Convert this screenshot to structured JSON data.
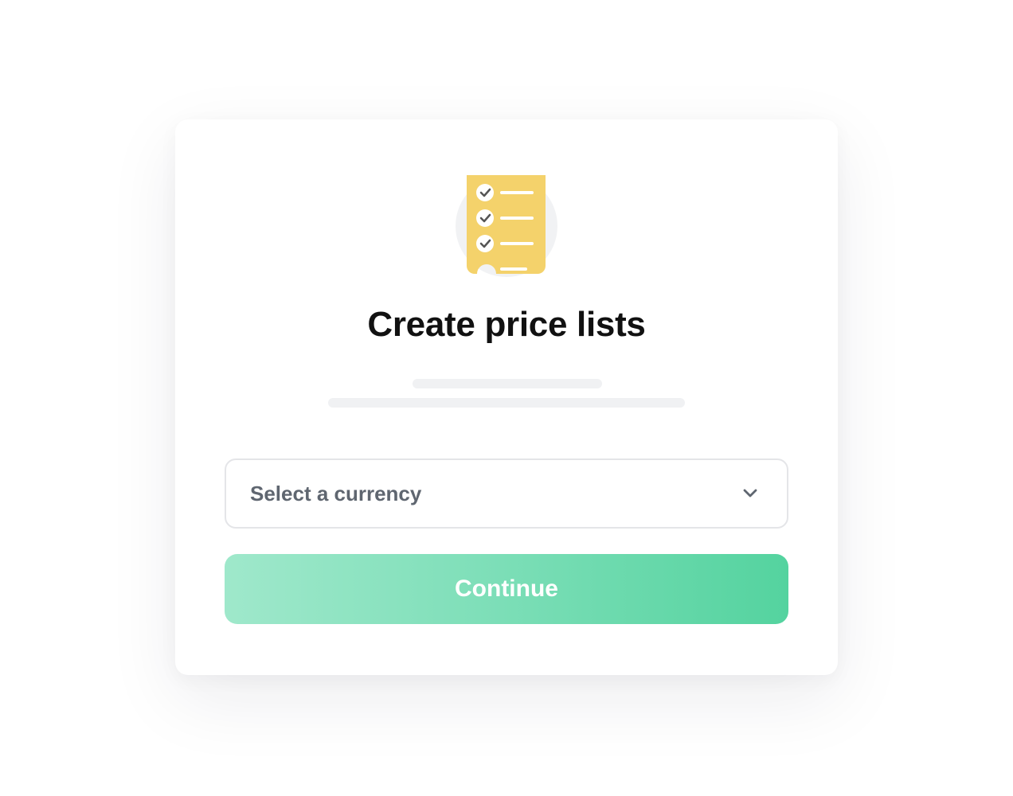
{
  "dialog": {
    "title": "Create price lists",
    "illustration_icon": "checklist-document-icon",
    "currency_select": {
      "placeholder": "Select a currency",
      "icon": "chevron-down-icon"
    },
    "continue_label": "Continue"
  },
  "colors": {
    "accent_start": "#9fe8cb",
    "accent_end": "#54d39f",
    "document_yellow": "#f4d26b",
    "text_primary": "#111111",
    "text_muted": "#5f6670"
  }
}
